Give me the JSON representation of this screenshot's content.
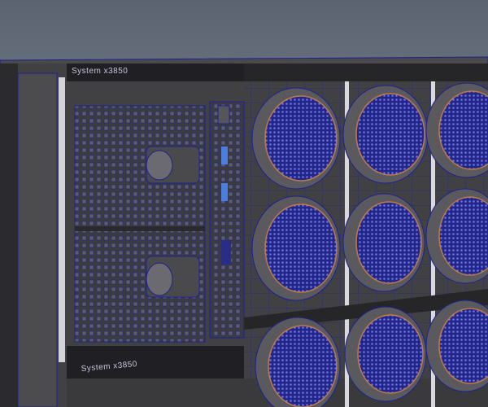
{
  "viewport": {
    "model_label_top": "System x3850",
    "model_label_bottom": "System x3850"
  },
  "colors": {
    "background": "#6f7a86",
    "body": "#3f3f3f",
    "wireframe": "#1a1f8a",
    "fan_mesh": "#2b2fa0"
  }
}
